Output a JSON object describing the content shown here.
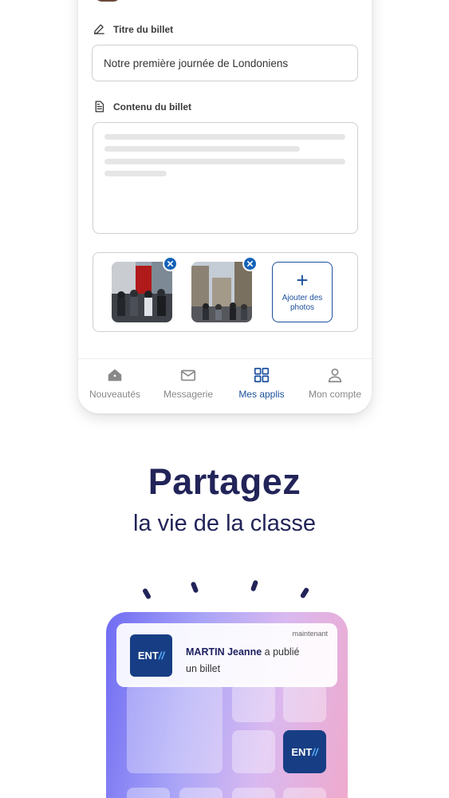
{
  "form": {
    "title_label": "Titre du billet",
    "title_value": "Notre première journée de Londoniens",
    "content_label": "Contenu du billet",
    "add_photos_label": "Ajouter des photos"
  },
  "nav": {
    "items": [
      {
        "label": "Nouveautés",
        "icon": "home-icon"
      },
      {
        "label": "Messagerie",
        "icon": "mail-icon"
      },
      {
        "label": "Mes applis",
        "icon": "apps-grid-icon",
        "active": true
      },
      {
        "label": "Mon compte",
        "icon": "user-icon"
      }
    ]
  },
  "headline": {
    "title": "Partagez",
    "subtitle": "la vie de la classe"
  },
  "notification": {
    "time": "maintenant",
    "author": "MARTIN Jeanne",
    "action": "a publié",
    "object": "un billet",
    "logo_text": "ENT"
  },
  "app_tile": {
    "logo_text": "ENT"
  },
  "colors": {
    "primary": "#1a4f9c",
    "headline": "#222459",
    "ent_blue": "#173e84"
  }
}
